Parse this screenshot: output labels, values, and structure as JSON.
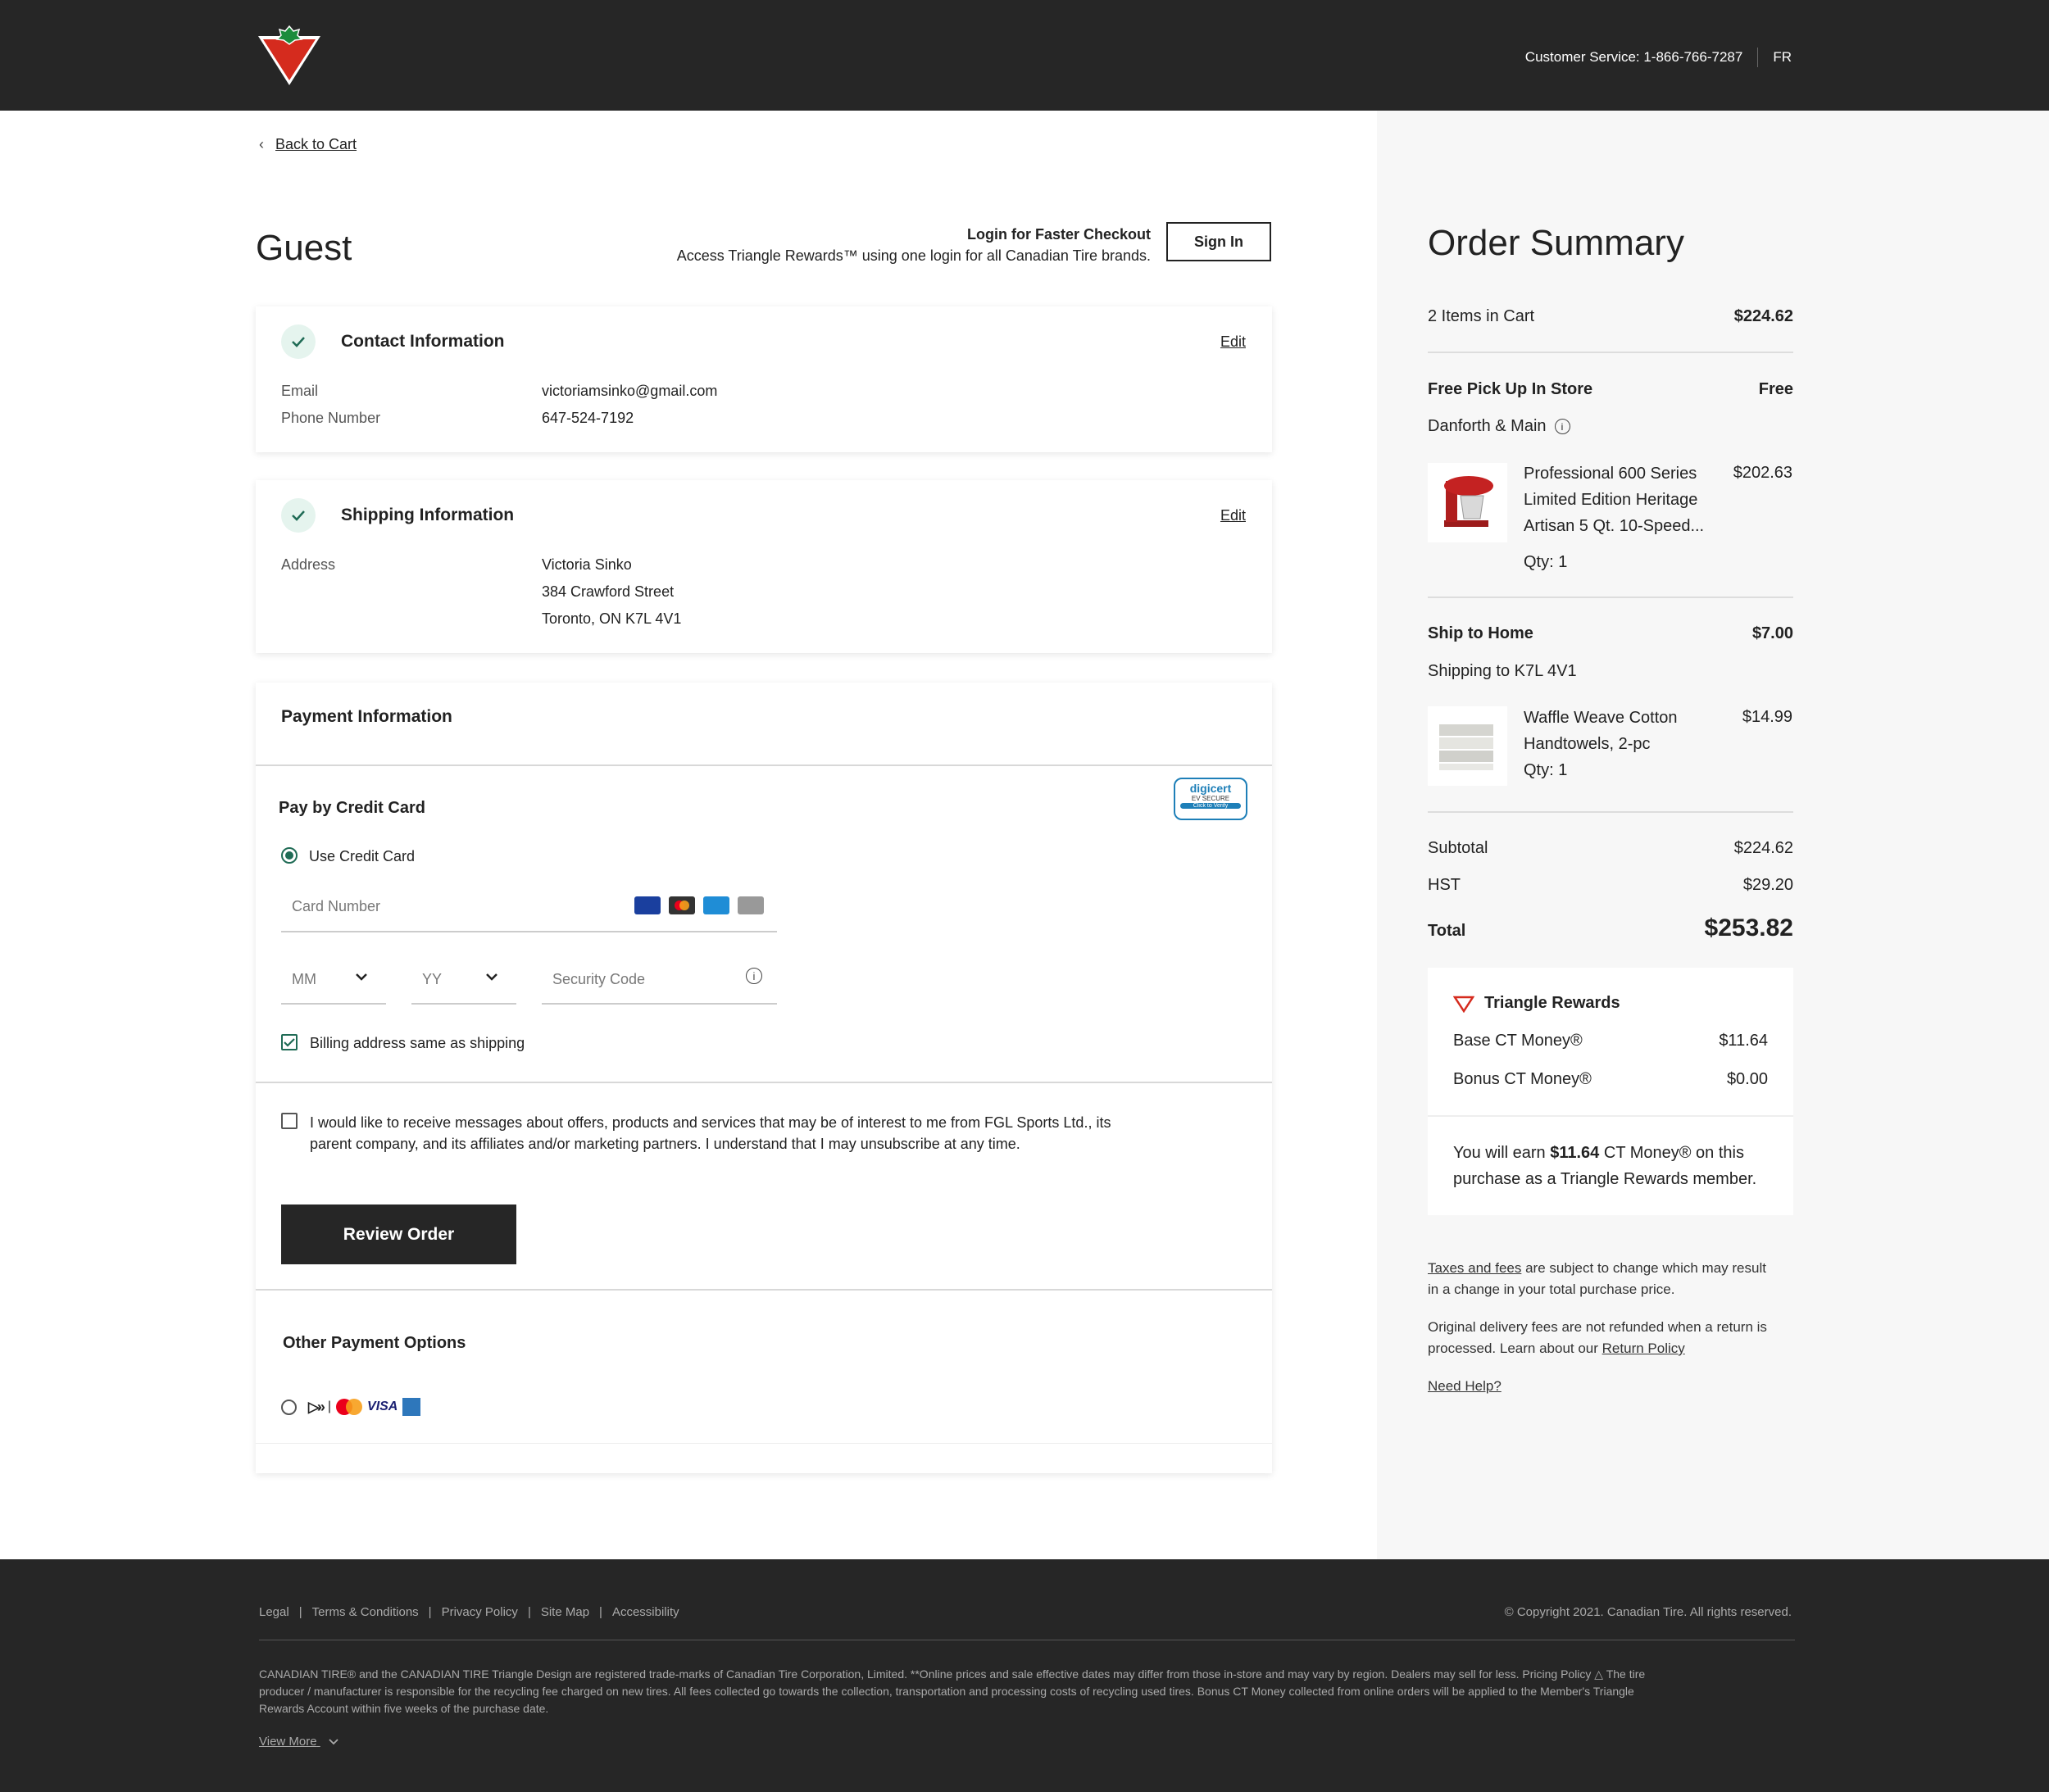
{
  "header": {
    "customer_service": "Customer Service: 1-866-766-7287",
    "lang": "FR"
  },
  "back_to_cart": "Back to Cart",
  "guest_title": "Guest",
  "login": {
    "heading": "Login for Faster Checkout",
    "subtext": "Access Triangle Rewards™ using one login for all Canadian Tire brands.",
    "button": "Sign In"
  },
  "contact": {
    "title": "Contact Information",
    "edit": "Edit",
    "email_label": "Email",
    "email_value": "victoriamsinko@gmail.com",
    "phone_label": "Phone Number",
    "phone_value": "647-524-7192"
  },
  "shipping": {
    "title": "Shipping Information",
    "edit": "Edit",
    "address_label": "Address",
    "address_lines": [
      "Victoria Sinko",
      "384 Crawford Street",
      "Toronto, ON K7L 4V1"
    ]
  },
  "payment": {
    "title": "Payment Information",
    "pay_by_cc": "Pay by Credit Card",
    "use_cc": "Use Credit Card",
    "card_number_placeholder": "Card Number",
    "mm": "MM",
    "yy": "YY",
    "security_code": "Security Code",
    "billing_same": "Billing address same as shipping",
    "opt_in": "I would like to receive messages about offers, products and services that may be of interest to me from FGL Sports Ltd., its",
    "opt_in_2": "parent company, and its affiliates and/or marketing partners. I understand that I may unsubscribe at any time.",
    "review_order": "Review Order",
    "other_options": "Other Payment Options",
    "digicert_1": "digicert",
    "digicert_2": "EV SECURE",
    "digicert_3": "Click to Verify",
    "card_brands": [
      "VISA",
      "mastercard",
      "amex",
      "generic"
    ],
    "other_brands": "VISA"
  },
  "summary": {
    "title": "Order Summary",
    "items_label": "2 Items in Cart",
    "items_total": "$224.62",
    "pickup_label": "Free Pick Up In Store",
    "pickup_value": "Free",
    "store": "Danforth & Main",
    "item1_name_1": "Professional 600 Series",
    "item1_name_2": "Limited Edition Heritage",
    "item1_name_3": "Artisan 5 Qt. 10-Speed...",
    "item1_qty": "Qty: 1",
    "item1_price": "$202.63",
    "ship_label": "Ship to Home",
    "ship_value": "$7.00",
    "ship_to": "Shipping to K7L 4V1",
    "item2_name_1": "Waffle Weave Cotton",
    "item2_name_2": "Handtowels, 2-pc",
    "item2_qty": "Qty: 1",
    "item2_price": "$14.99",
    "subtotal_label": "Subtotal",
    "subtotal_value": "$224.62",
    "hst_label": "HST",
    "hst_value": "$29.20",
    "total_label": "Total",
    "total_value": "$253.82"
  },
  "rewards": {
    "title": "Triangle Rewards",
    "base_label": "Base CT Money®",
    "base_value": "$11.64",
    "bonus_label": "Bonus CT Money®",
    "bonus_value": "$0.00",
    "earn_pre": "You will earn ",
    "earn_amount": "$11.64",
    "earn_post": " CT Money® on this",
    "earn_line2": "purchase as a Triangle Rewards member."
  },
  "notes": {
    "taxes_link": "Taxes and fees",
    "taxes_rest": " are subject to change which may result",
    "taxes_line2": "in a change in your total purchase price.",
    "delivery_line1": "Original delivery fees are not refunded when a return is",
    "delivery_pre": "processed. Learn about our ",
    "return_link": "Return Policy",
    "need_help": "Need Help?"
  },
  "footer": {
    "links": [
      "Legal",
      "Terms & Conditions",
      "Privacy Policy",
      "Site Map",
      "Accessibility"
    ],
    "copyright": "©  Copyright 2021. Canadian Tire. All rights reserved.",
    "legal_1": "CANADIAN TIRE® and the CANADIAN TIRE Triangle Design are registered trade-marks of Canadian Tire Corporation, Limited. **Online prices and sale effective dates may differ from those in-store and may vary by region. Dealers may sell for less. Pricing Policy △ The tire",
    "legal_2": "producer / manufacturer is responsible for the recycling fee charged on new tires. All fees collected go towards the collection, transportation and processing costs of recycling used tires. Bonus CT Money collected from online orders will be applied to the Member's Triangle",
    "legal_3": "Rewards Account within five weeks of the purchase date.",
    "view_more": "View More"
  },
  "colors": {
    "header_bg": "#262626",
    "accent_green": "#1f6b55",
    "brand_red": "#d52b1e"
  }
}
